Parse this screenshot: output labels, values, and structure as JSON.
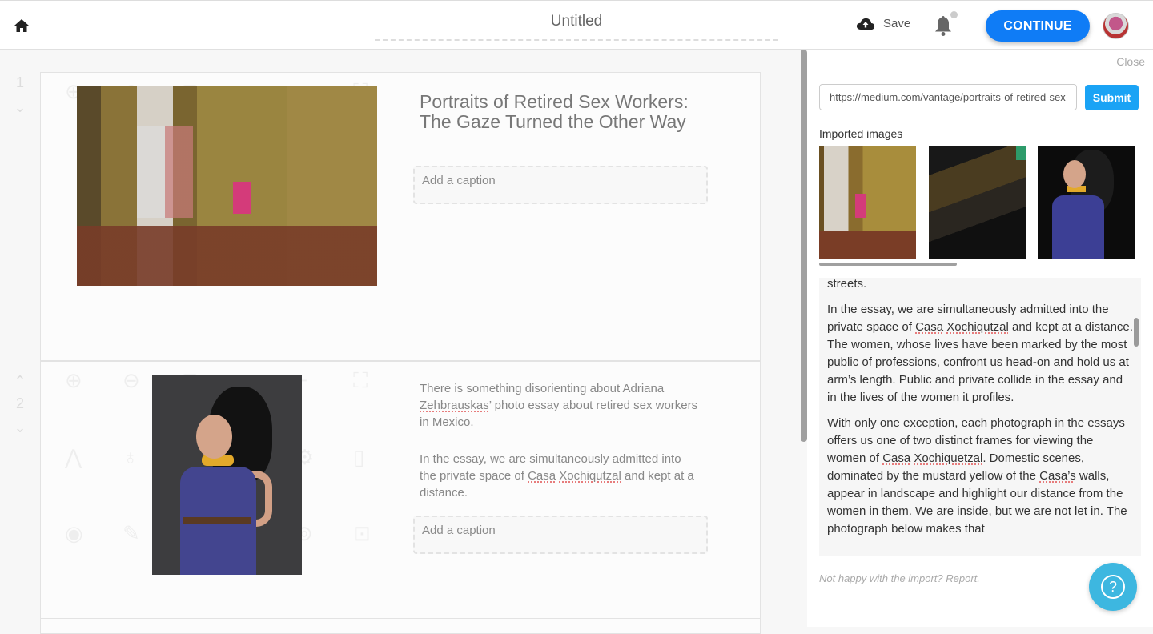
{
  "header": {
    "document_title": "Untitled",
    "save_label": "Save",
    "continue_label": "CONTINUE",
    "icons": {
      "home": "home-icon",
      "save": "cloud-upload-icon",
      "notifications": "bell-icon",
      "avatar": "user-avatar"
    }
  },
  "editor": {
    "blocks": [
      {
        "number": "1",
        "headline": "Portraits of Retired Sex Workers: The Gaze Turned the Other Way",
        "caption_placeholder": "Add a caption"
      },
      {
        "number": "2",
        "paragraphs": [
          {
            "before": "There is something disorienting about Adriana ",
            "misspelled": "Zehbrauskas",
            "after": "’ photo essay about retired sex workers in Mexico."
          },
          {
            "before": "In the essay, we are simultaneously admitted into the private space of ",
            "misspelled_1": "Casa",
            "middle": " ",
            "misspelled_2": "Xochiqutzal",
            "after": " and kept at a distance."
          }
        ],
        "caption_placeholder": "Add a caption"
      }
    ],
    "gutter_icons": {
      "up": "chevron-up-icon",
      "down": "chevron-down-icon"
    }
  },
  "import_panel": {
    "close_label": "Close",
    "url_value": "https://medium.com/vantage/portraits-of-retired-sex-workers",
    "submit_label": "Submit",
    "imported_images_label": "Imported images",
    "images": [
      {
        "alt": "Domestic interior with mustard yellow walls"
      },
      {
        "alt": "Building facade in shadow"
      },
      {
        "alt": "Portrait of woman in blue dress"
      }
    ],
    "article_paragraphs": [
      {
        "text": "streets."
      },
      {
        "before": "In the essay, we are simultaneously admitted into the private space of ",
        "m1": "Casa",
        "mid": " ",
        "m2": "Xochiqutzal",
        "after": " and kept at a distance. The women, whose lives have been marked by the most public of professions, confront us head-on and hold us at arm’s length. Public and private collide in the essay and in the lives of the women it profiles."
      },
      {
        "before": "With only one exception, each photograph in the essays offers us one of two distinct frames for viewing the women of ",
        "m1": "Casa",
        "mid": " ",
        "m2": "Xochiquetzal",
        "after1": ". Domestic scenes, dominated by the mustard yellow of the ",
        "m3": "Casa’s",
        "after": " walls, appear in landscape and highlight our distance from the women in them. We are inside, but we are not let in. The photograph below makes that"
      }
    ],
    "report_text": "Not happy with the import? Report."
  },
  "help": {
    "label": "?"
  },
  "colors": {
    "primary": "#0f7cf6",
    "submit": "#1aa3f5",
    "help": "#3db7e0"
  }
}
